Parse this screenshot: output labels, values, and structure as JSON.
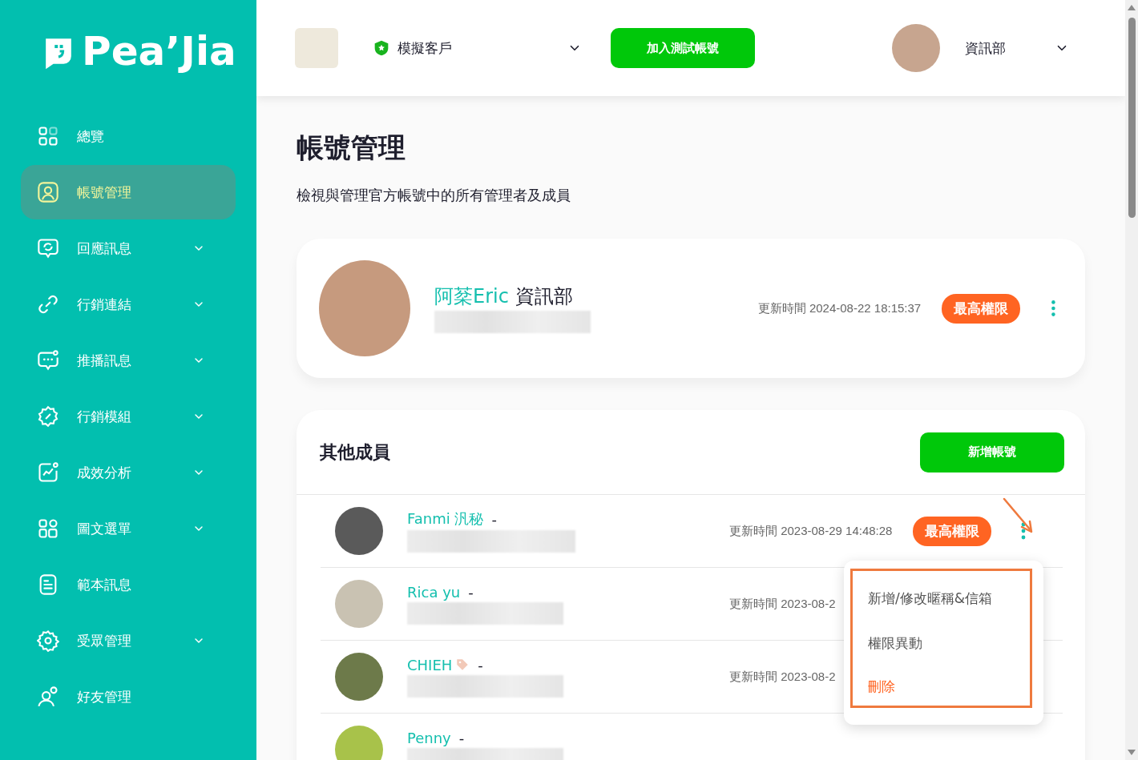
{
  "sidebar": {
    "logo": "Pea’Jia",
    "items": [
      {
        "label": "總覽",
        "expandable": false,
        "selected": false
      },
      {
        "label": "帳號管理",
        "expandable": false,
        "selected": true
      },
      {
        "label": "回應訊息",
        "expandable": true,
        "selected": false
      },
      {
        "label": "行銷連結",
        "expandable": true,
        "selected": false
      },
      {
        "label": "推播訊息",
        "expandable": true,
        "selected": false
      },
      {
        "label": "行銷模組",
        "expandable": true,
        "selected": false
      },
      {
        "label": "成效分析",
        "expandable": true,
        "selected": false
      },
      {
        "label": "圖文選單",
        "expandable": true,
        "selected": false
      },
      {
        "label": "範本訊息",
        "expandable": false,
        "selected": false
      },
      {
        "label": "受眾管理",
        "expandable": true,
        "selected": false
      },
      {
        "label": "好友管理",
        "expandable": false,
        "selected": false
      }
    ]
  },
  "header": {
    "account_name": "模擬客戶",
    "test_button": "加入測試帳號",
    "user": "資訊部"
  },
  "page": {
    "title": "帳號管理",
    "subtitle": "檢視與管理官方帳號中的所有管理者及成員"
  },
  "owner": {
    "name": "阿棻Eric",
    "department": "資訊部",
    "updated": "更新時間 2024-08-22 18:15:37",
    "badge": "最高權限"
  },
  "members": {
    "title": "其他成員",
    "add_button": "新增帳號",
    "rows": [
      {
        "name": "Fanmi 汎秘",
        "separator": "-",
        "tag_icon": false,
        "updated": "更新時間 2023-08-29 14:48:28",
        "badge": "最高權限"
      },
      {
        "name": "Rica yu",
        "separator": "-",
        "tag_icon": false,
        "updated": "更新時間 2023-08-2"
      },
      {
        "name": "CHIEH",
        "separator": "-",
        "tag_icon": true,
        "updated": "更新時間 2023-08-2"
      },
      {
        "name": "Penny",
        "separator": "-",
        "tag_icon": false
      }
    ]
  },
  "context_menu": {
    "items": [
      {
        "label": "新增/修改暱稱&信箱",
        "kind": "normal"
      },
      {
        "label": "權限異動",
        "kind": "normal"
      },
      {
        "label": "刪除",
        "kind": "danger"
      }
    ]
  }
}
